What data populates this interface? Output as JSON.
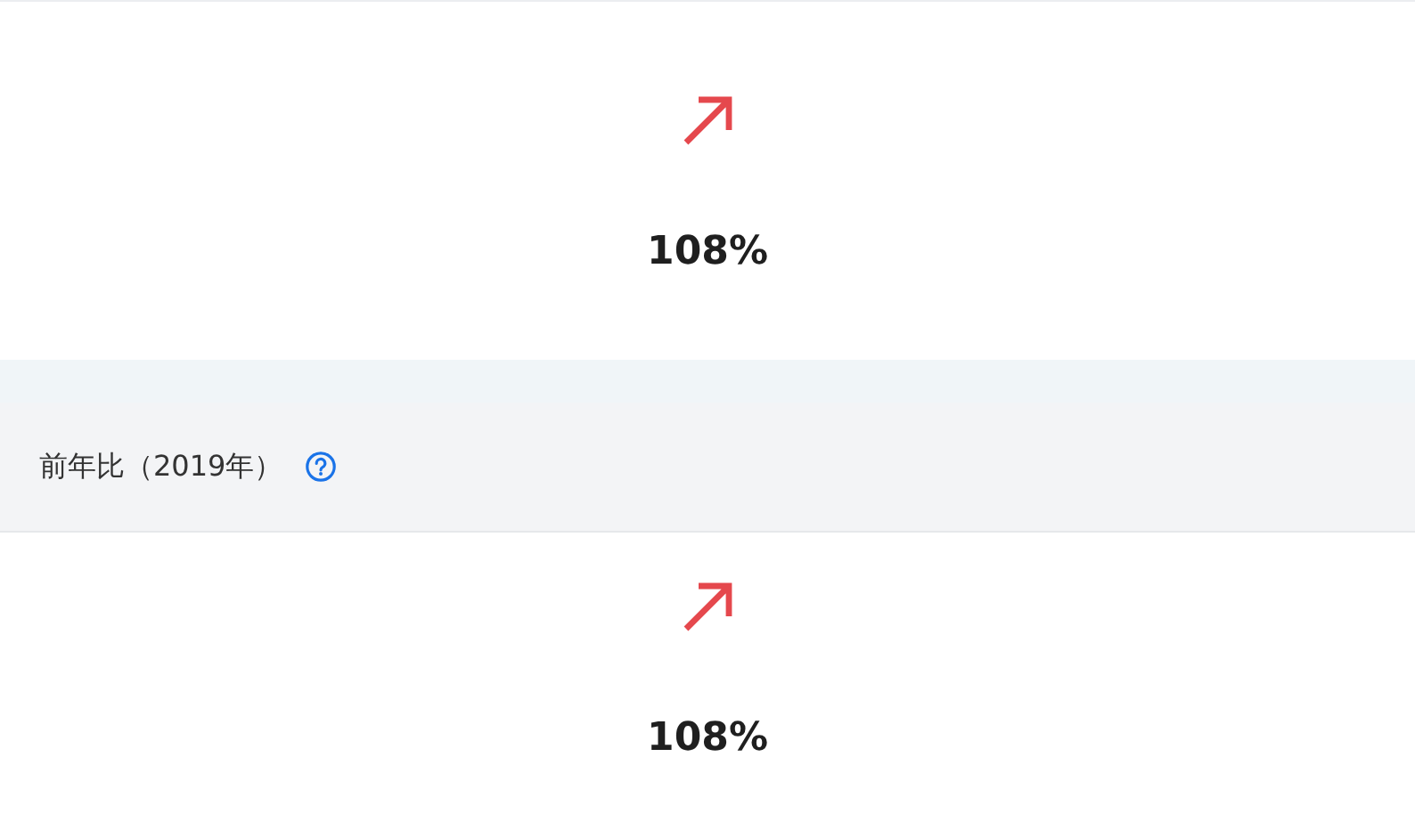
{
  "sections": [
    {
      "kind": "up",
      "value": "108%"
    },
    {
      "title": "前年比（2019年）",
      "kind": "up",
      "value": "108%"
    }
  ]
}
